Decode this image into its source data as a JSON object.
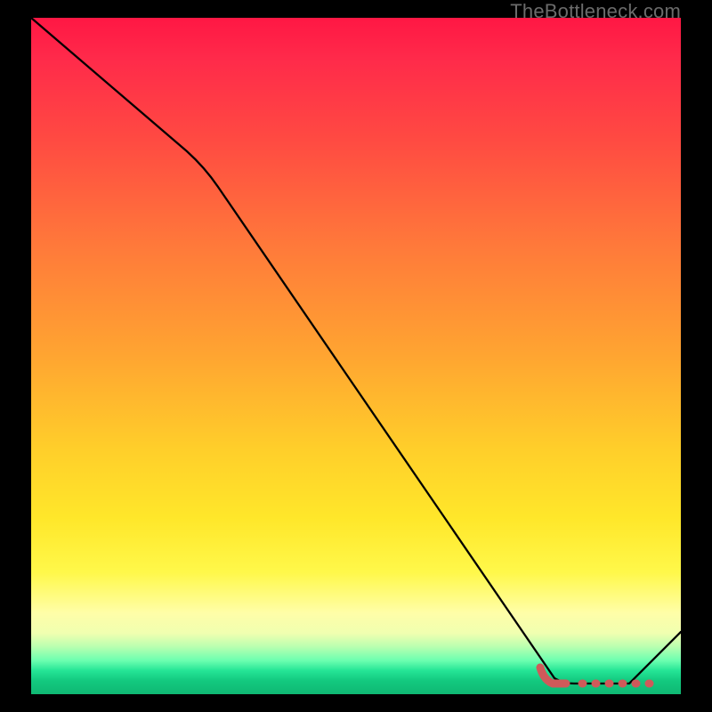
{
  "attribution": "TheBottleneck.com",
  "chart_data": {
    "type": "line",
    "title": "",
    "xlabel": "",
    "ylabel": "",
    "xlim": [
      0,
      100
    ],
    "ylim": [
      0,
      100
    ],
    "series": [
      {
        "name": "bottleneck-curve",
        "x": [
          0,
          25,
          80,
          92,
          100
        ],
        "y": [
          100,
          80,
          2,
          2,
          10
        ]
      }
    ],
    "highlight": {
      "name": "optimal-flat-region",
      "x_start": 78,
      "x_end": 92,
      "y": 2
    },
    "background_gradient": {
      "top": "#ff1744",
      "mid_upper": "#ff7a3a",
      "mid": "#ffcf2a",
      "mid_lower": "#fffea8",
      "bottom": "#0fb873"
    }
  }
}
